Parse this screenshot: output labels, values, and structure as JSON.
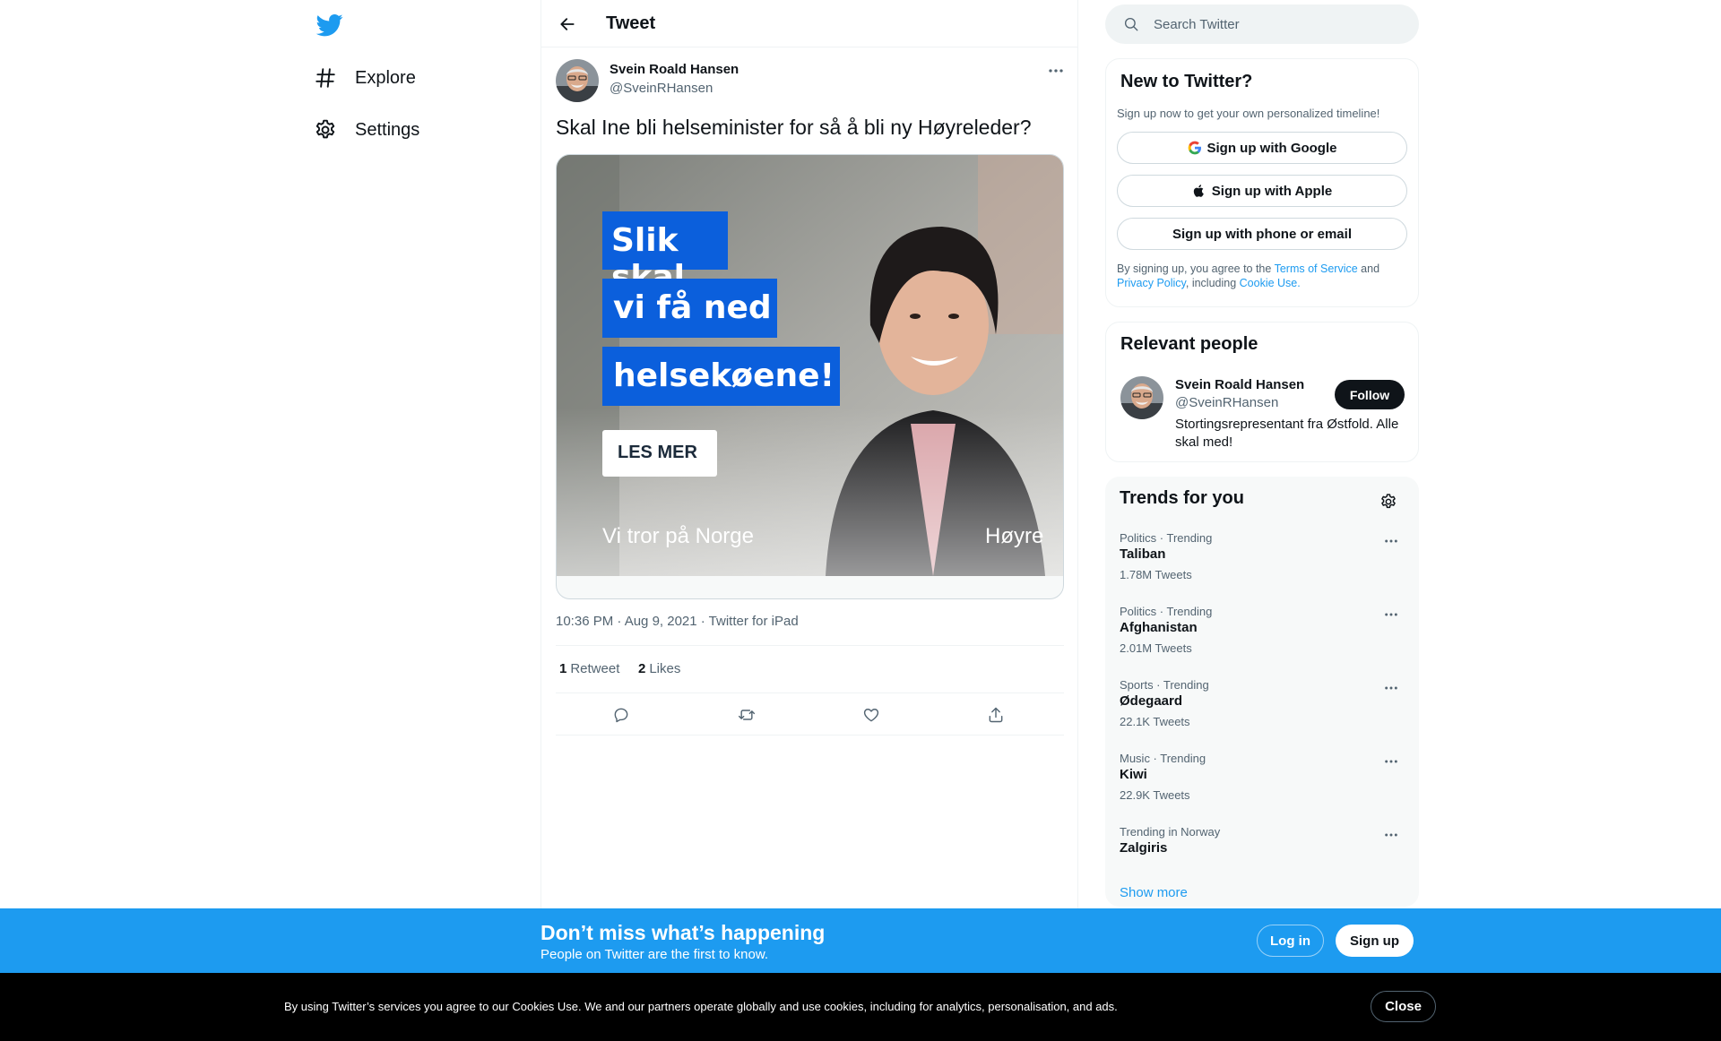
{
  "nav": {
    "explore_label": "Explore",
    "settings_label": "Settings"
  },
  "header": {
    "title": "Tweet"
  },
  "tweet": {
    "author_name": "Svein Roald Hansen",
    "author_handle": "@SveinRHansen",
    "text": "Skal Ine bli helseminister for så å bli ny Høyreleder?",
    "media": {
      "line1": "Slik skal",
      "line2": "vi få ned",
      "line3": "helsekøene!",
      "cta": "LES MER",
      "tagline": "Vi tror på Norge",
      "brand": "Høyre"
    },
    "meta": "10:36 PM · Aug 9, 2021 · Twitter for iPad",
    "retweet_count": "1",
    "retweet_label": "Retweet",
    "like_count": "2",
    "like_label": "Likes"
  },
  "search": {
    "placeholder": "Search Twitter"
  },
  "signup_card": {
    "title": "New to Twitter?",
    "subtitle": "Sign up now to get your own personalized timeline!",
    "google_label": "Sign up with Google",
    "apple_label": "Sign up with Apple",
    "phone_label": "Sign up with phone or email",
    "legal_prefix": "By signing up, you agree to the ",
    "terms_link": "Terms of Service",
    "legal_and": " and ",
    "privacy_link": "Privacy Policy",
    "legal_including": ", including ",
    "cookie_link": "Cookie Use."
  },
  "relevant": {
    "title": "Relevant people",
    "name": "Svein Roald Hansen",
    "handle": "@SveinRHansen",
    "bio": "Stortingsrepresentant fra Østfold. Alle skal med!",
    "follow_label": "Follow"
  },
  "trends": {
    "title": "Trends for you",
    "items": [
      {
        "context": "Politics · Trending",
        "name": "Taliban",
        "count": "1.78M Tweets"
      },
      {
        "context": "Politics · Trending",
        "name": "Afghanistan",
        "count": "2.01M Tweets"
      },
      {
        "context": "Sports · Trending",
        "name": "Ødegaard",
        "count": "22.1K Tweets"
      },
      {
        "context": "Music · Trending",
        "name": "Kiwi",
        "count": "22.9K Tweets"
      },
      {
        "context": "Trending in Norway",
        "name": "Zalgiris",
        "count": ""
      }
    ],
    "show_more": "Show more"
  },
  "bottom_bar": {
    "title": "Don’t miss what’s happening",
    "subtitle": "People on Twitter are the first to know.",
    "login_label": "Log in",
    "signup_label": "Sign up"
  },
  "cookie_bar": {
    "text": "By using Twitter’s services you agree to our Cookies Use. We and our partners operate globally and use cookies, including for analytics, personalisation, and ads.",
    "close_label": "Close"
  },
  "colors": {
    "brand_blue": "#1d9bf0",
    "text_primary": "#0f1419",
    "text_secondary": "#536471",
    "media_banner_blue": "#0b5fdc"
  }
}
